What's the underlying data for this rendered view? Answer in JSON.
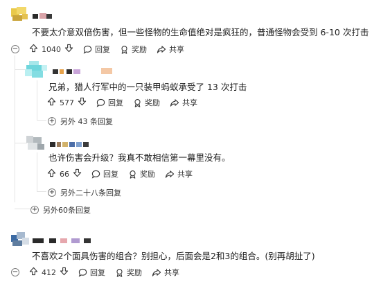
{
  "comments": [
    {
      "text": "不要太介意双倍伤害，但一些怪物的生命值绝对是疯狂的，普通怪物会受到 6-10 次打击",
      "votes": "1040",
      "reply_label": "回复",
      "award_label": "奖励",
      "share_label": "共享",
      "more_replies": "另外60条回复",
      "collapse_symbol": "−",
      "replies": [
        {
          "text": "兄弟，猎人行军中的一只装甲蚂蚁承受了 13 次打击",
          "votes": "577",
          "reply_label": "回复",
          "award_label": "奖励",
          "share_label": "共享",
          "more_replies": "另外 43 条回复"
        },
        {
          "text": "也许伤害会升级？我真不敢相信第一幕里没有。",
          "votes": "66",
          "reply_label": "回复",
          "award_label": "奖励",
          "share_label": "共享",
          "more_replies": "另外二十八条回复"
        }
      ]
    },
    {
      "text": "不喜欢2个面具伤害的组合？别担心，后面会是2和3的组合。(别再胡扯了)",
      "votes": "412",
      "reply_label": "回复",
      "award_label": "奖励",
      "share_label": "共享",
      "collapse_symbol": "−"
    }
  ],
  "icons": {
    "upvote": "arrow-up-icon",
    "downvote": "arrow-down-icon",
    "reply": "speech-bubble-icon",
    "award": "award-ribbon-icon",
    "share": "share-arrow-icon",
    "expand": "plus-circle-icon",
    "collapse": "minus-circle-icon"
  },
  "colors": {
    "text": "#1c1c1c",
    "muted": "#333333",
    "thread_line": "#e3e3e3"
  }
}
